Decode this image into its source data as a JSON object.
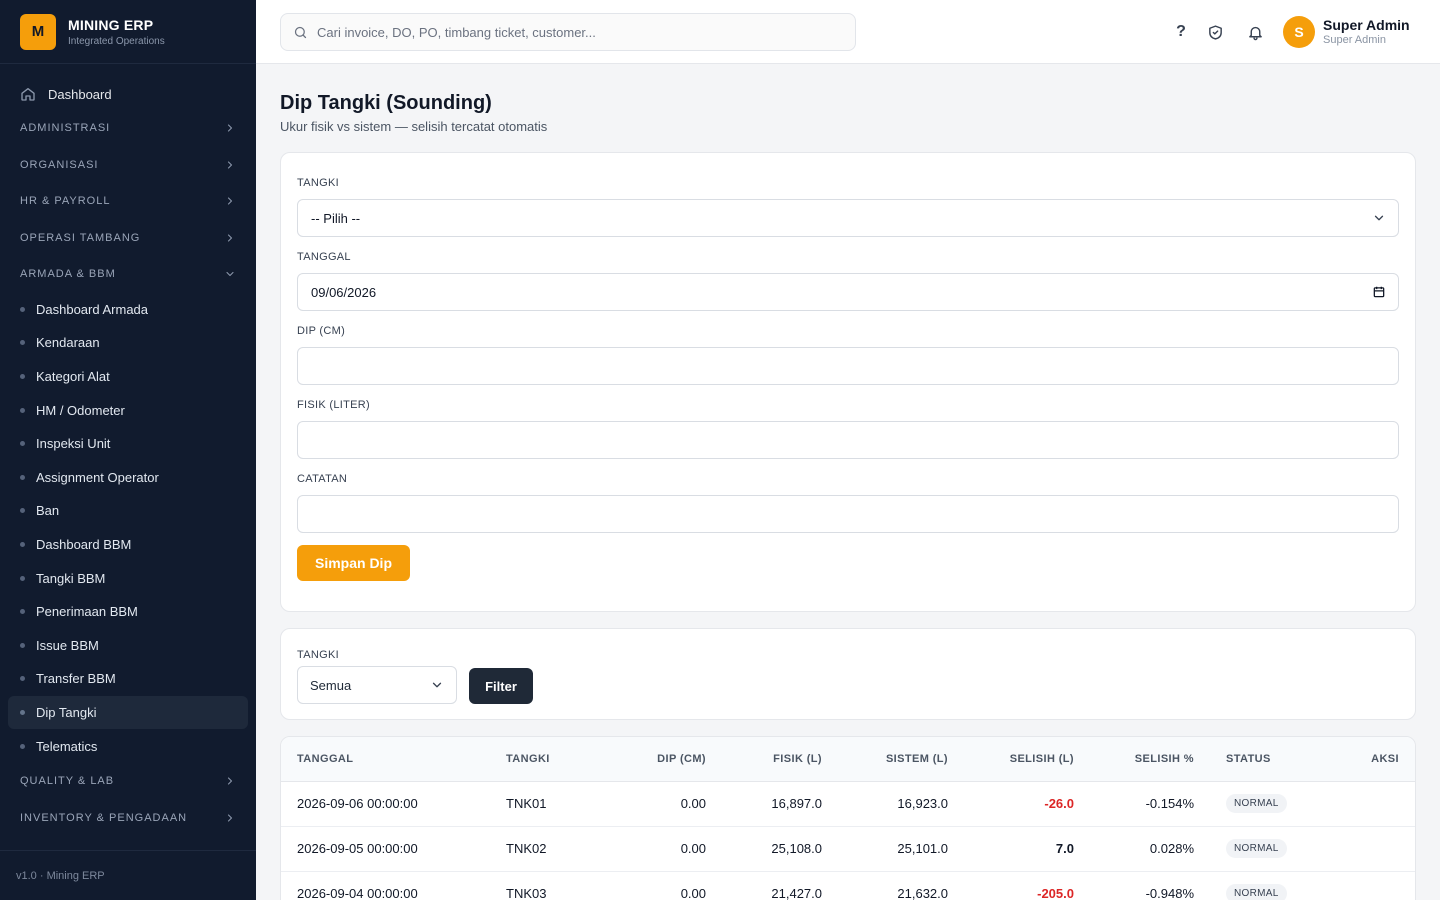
{
  "brand": {
    "logo_letter": "M",
    "name": "MINING ERP",
    "subtitle": "Integrated Operations"
  },
  "sidebar": {
    "dashboard_label": "Dashboard",
    "sections": [
      {
        "label": "ADMINISTRASI",
        "expanded": false
      },
      {
        "label": "ORGANISASI",
        "expanded": false
      },
      {
        "label": "HR & PAYROLL",
        "expanded": false
      },
      {
        "label": "OPERASI TAMBANG",
        "expanded": false
      },
      {
        "label": "ARMADA & BBM",
        "expanded": true
      }
    ],
    "items": [
      "Dashboard Armada",
      "Kendaraan",
      "Kategori Alat",
      "HM / Odometer",
      "Inspeksi Unit",
      "Assignment Operator",
      "Ban",
      "Dashboard BBM",
      "Tangki BBM",
      "Penerimaan BBM",
      "Issue BBM",
      "Transfer BBM",
      "Dip Tangki",
      "Telematics"
    ],
    "active_item": "Dip Tangki",
    "sections_after": [
      {
        "label": "QUALITY & LAB",
        "expanded": false
      },
      {
        "label": "INVENTORY & PENGADAAN",
        "expanded": false
      }
    ],
    "footer": "v1.0 · Mining ERP"
  },
  "topbar": {
    "search_placeholder": "Cari invoice, DO, PO, timbang ticket, customer...",
    "help_label": "?",
    "user_initial": "S",
    "user_name": "Super Admin",
    "user_role": "Super Admin"
  },
  "page": {
    "title": "Dip Tangki (Sounding)",
    "subtitle": "Ukur fisik vs sistem — selisih tercatat otomatis"
  },
  "form": {
    "tangki_label": "TANGKI",
    "tangki_value": "-- Pilih --",
    "tanggal_label": "TANGGAL",
    "tanggal_value": "09/06/2026",
    "dip_label": "DIP (CM)",
    "dip_value": "",
    "fisik_label": "FISIK (LITER)",
    "fisik_value": "",
    "catatan_label": "CATATAN",
    "catatan_value": "",
    "save_label": "Simpan Dip"
  },
  "filter": {
    "label": "TANGKI",
    "value": "Semua",
    "button_label": "Filter"
  },
  "table": {
    "headers": [
      "TANGGAL",
      "TANGKI",
      "DIP (CM)",
      "FISIK (L)",
      "SISTEM (L)",
      "SELISIH (L)",
      "SELISIH %",
      "STATUS",
      "AKSI"
    ],
    "rows": [
      {
        "tanggal": "2026-09-06 00:00:00",
        "tangki": "TNK01",
        "dip": "0.00",
        "fisik": "16,897.0",
        "sistem": "16,923.0",
        "selisih": "-26.0",
        "selisih_pct": "-0.154%",
        "status": "NORMAL",
        "negative": true
      },
      {
        "tanggal": "2026-09-05 00:00:00",
        "tangki": "TNK02",
        "dip": "0.00",
        "fisik": "25,108.0",
        "sistem": "25,101.0",
        "selisih": "7.0",
        "selisih_pct": "0.028%",
        "status": "NORMAL",
        "negative": false
      },
      {
        "tanggal": "2026-09-04 00:00:00",
        "tangki": "TNK03",
        "dip": "0.00",
        "fisik": "21,427.0",
        "sistem": "21,632.0",
        "selisih": "-205.0",
        "selisih_pct": "-0.948%",
        "status": "NORMAL",
        "negative": true
      }
    ]
  },
  "colors": {
    "sidebar_bg": "#111b2e",
    "accent": "#f59e0b",
    "negative": "#dc2626",
    "dark_button": "#1f2937"
  }
}
